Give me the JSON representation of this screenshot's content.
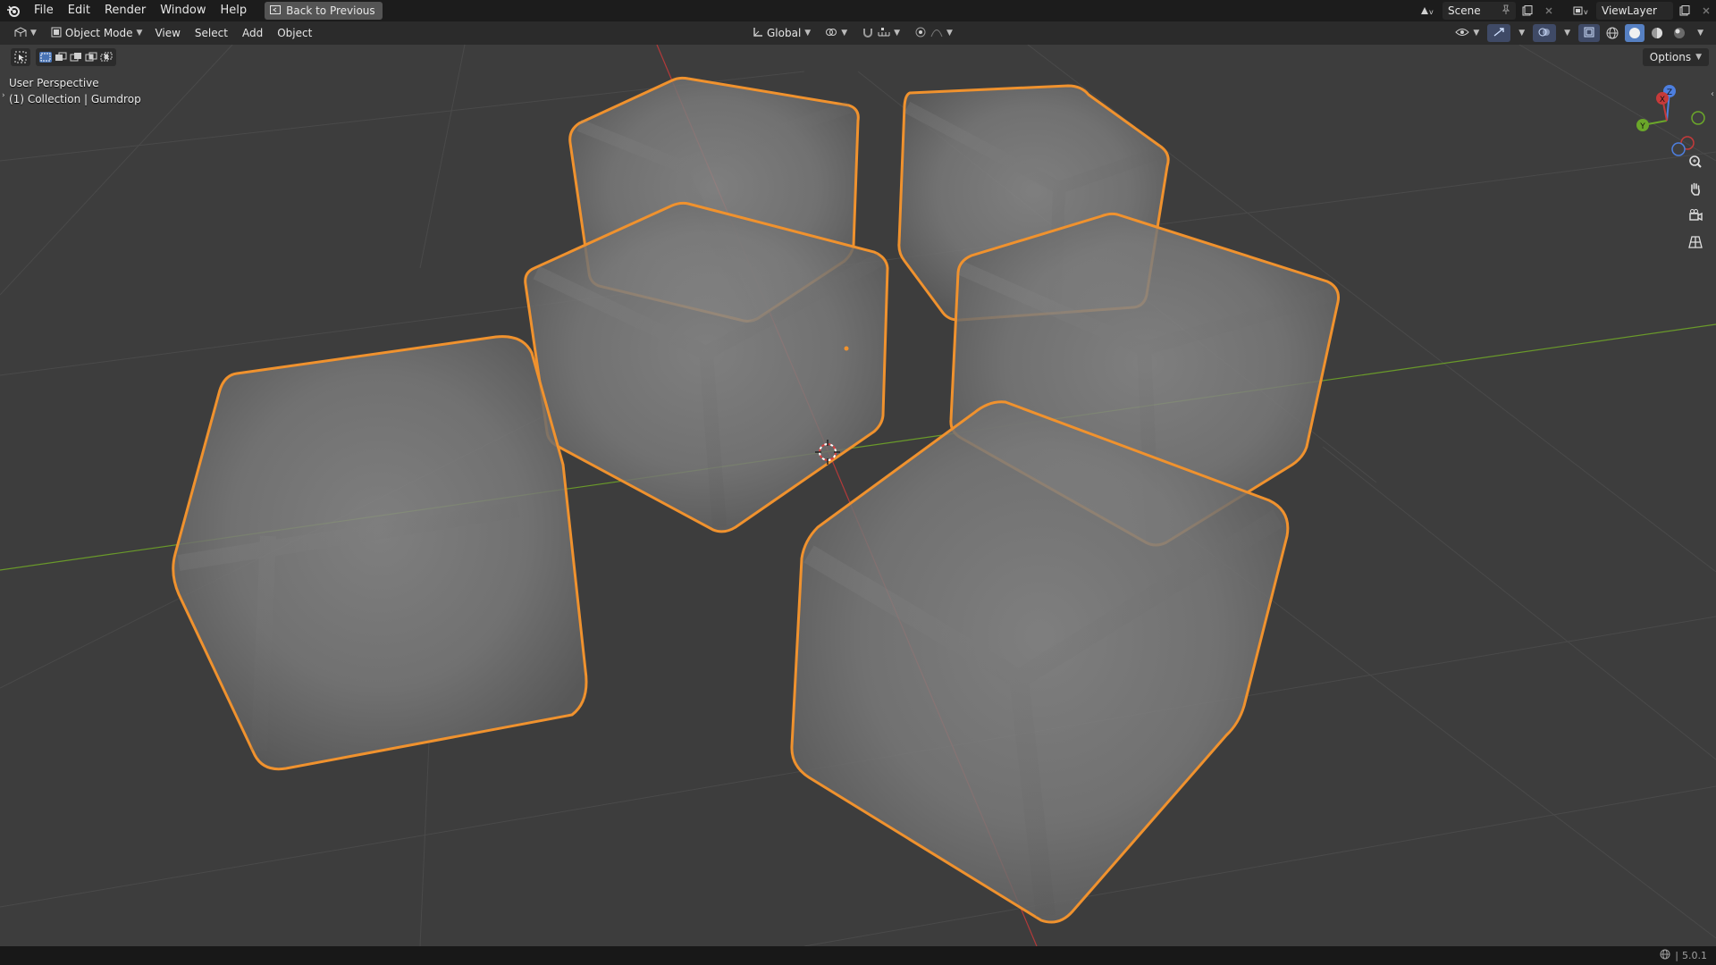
{
  "menubar": {
    "items": [
      "File",
      "Edit",
      "Render",
      "Window",
      "Help"
    ],
    "back_label": "Back to Previous",
    "scene_name": "Scene",
    "view_layer_name": "ViewLayer"
  },
  "viewport_header": {
    "mode_label": "Object Mode",
    "menus": [
      "View",
      "Select",
      "Add",
      "Object"
    ],
    "transform_orientation": "Global",
    "options_label": "Options"
  },
  "viewport": {
    "perspective_label": "User Perspective",
    "collection_label": "(1) Collection | Gumdrop",
    "gizmo_axes": [
      "X",
      "Y",
      "Z"
    ],
    "selection_color": "#f0922e",
    "x_axis_color": "#c83c3c",
    "y_axis_color": "#7bbd2a"
  },
  "statusbar": {
    "version": "5.0.1"
  }
}
